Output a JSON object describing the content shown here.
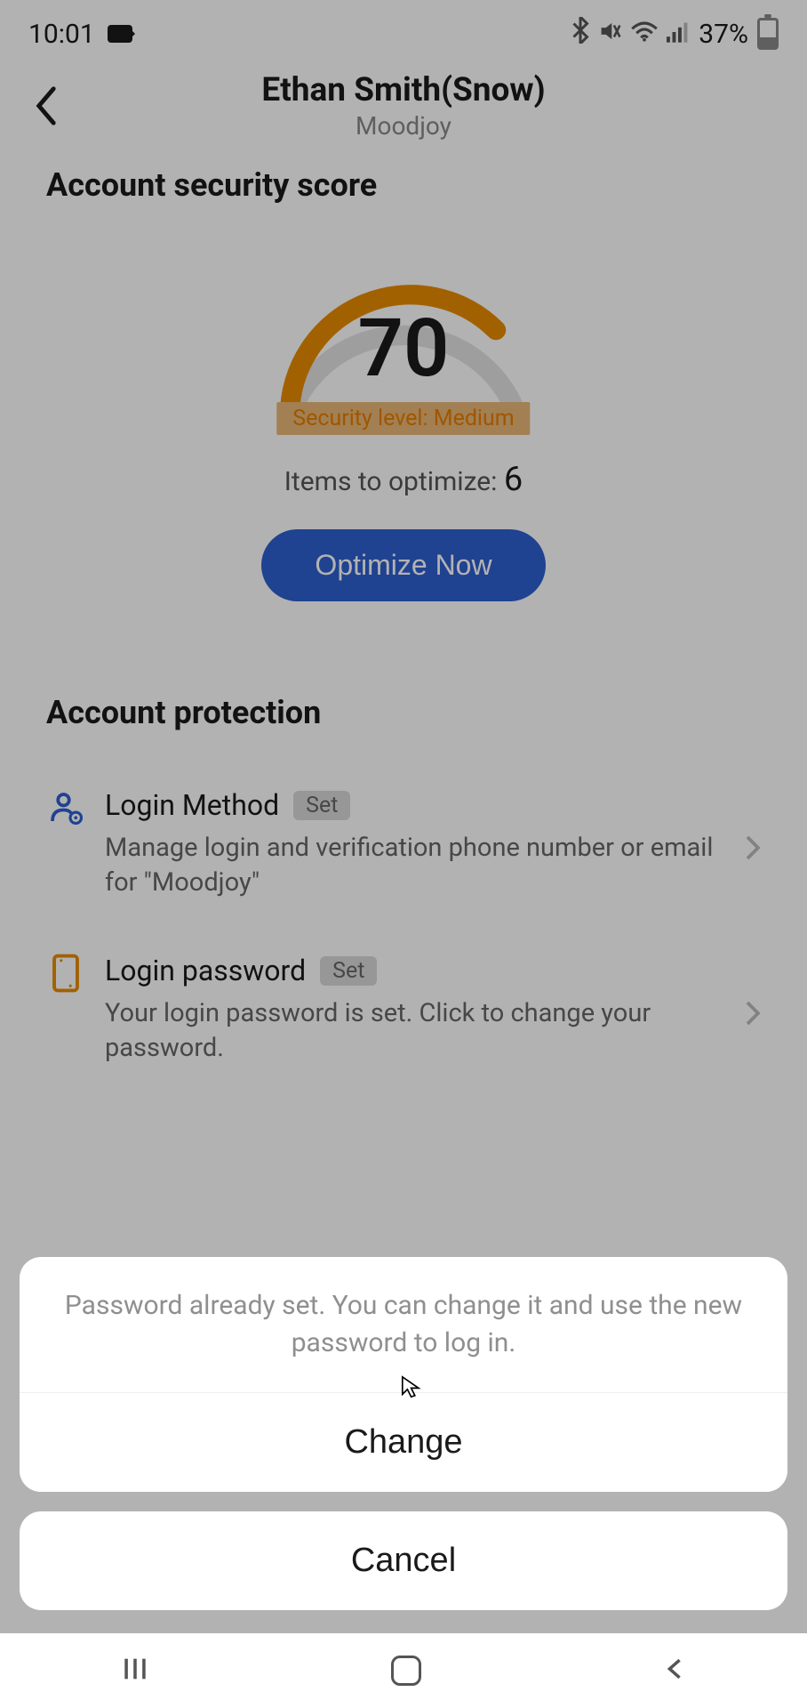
{
  "status": {
    "time": "10:01",
    "battery": "37%"
  },
  "header": {
    "title": "Ethan Smith(Snow)",
    "subtitle": "Moodjoy"
  },
  "score_card": {
    "title": "Account security score",
    "score": "70",
    "level_label": "Security level: Medium",
    "optimize_prefix": "Items to optimize: ",
    "optimize_count": "6",
    "optimize_btn": "Optimize Now"
  },
  "protection": {
    "title": "Account protection",
    "items": [
      {
        "title": "Login Method",
        "tag": "Set",
        "desc": "Manage login and verification phone number or email for \"Moodjoy\""
      },
      {
        "title": "Login password",
        "tag": "Set",
        "desc": "Your login password is set. Click to change your password."
      }
    ]
  },
  "dialog": {
    "message": "Password already set. You can change it and use the new password to log in.",
    "change": "Change",
    "cancel": "Cancel"
  },
  "colors": {
    "accent": "#e88b00",
    "primary_btn": "#2d5fd0"
  }
}
